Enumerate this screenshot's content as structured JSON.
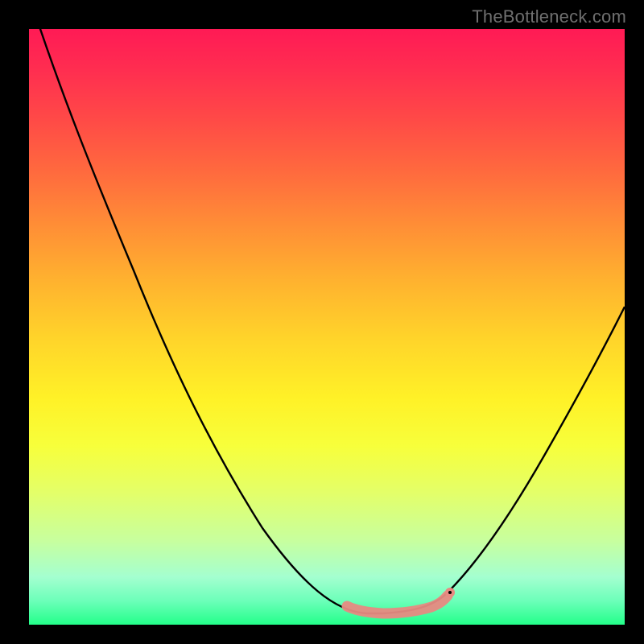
{
  "attribution": "TheBottleneck.com",
  "chart_data": {
    "type": "line",
    "title": "",
    "xlabel": "",
    "ylabel": "",
    "xlim": [
      0,
      100
    ],
    "ylim": [
      0,
      100
    ],
    "series": [
      {
        "name": "bottleneck-curve",
        "x": [
          0,
          5,
          10,
          15,
          20,
          25,
          30,
          35,
          40,
          45,
          50,
          54,
          58,
          62,
          66,
          70,
          72,
          76,
          80,
          84,
          88,
          92,
          96,
          100
        ],
        "y": [
          99,
          91,
          83,
          75,
          67,
          59,
          51,
          43,
          35,
          27,
          19,
          12,
          6,
          3,
          2,
          2,
          3,
          8,
          14,
          21,
          29,
          37,
          45,
          53
        ]
      },
      {
        "name": "highlight-band",
        "x": [
          54,
          58,
          62,
          66,
          70,
          72
        ],
        "y": [
          5,
          3,
          2,
          2,
          3,
          5
        ]
      }
    ],
    "colors": {
      "curve": "#000000",
      "highlight": "#e78a82",
      "gradient_top": "#ff1a55",
      "gradient_bottom": "#23ff8a"
    }
  }
}
